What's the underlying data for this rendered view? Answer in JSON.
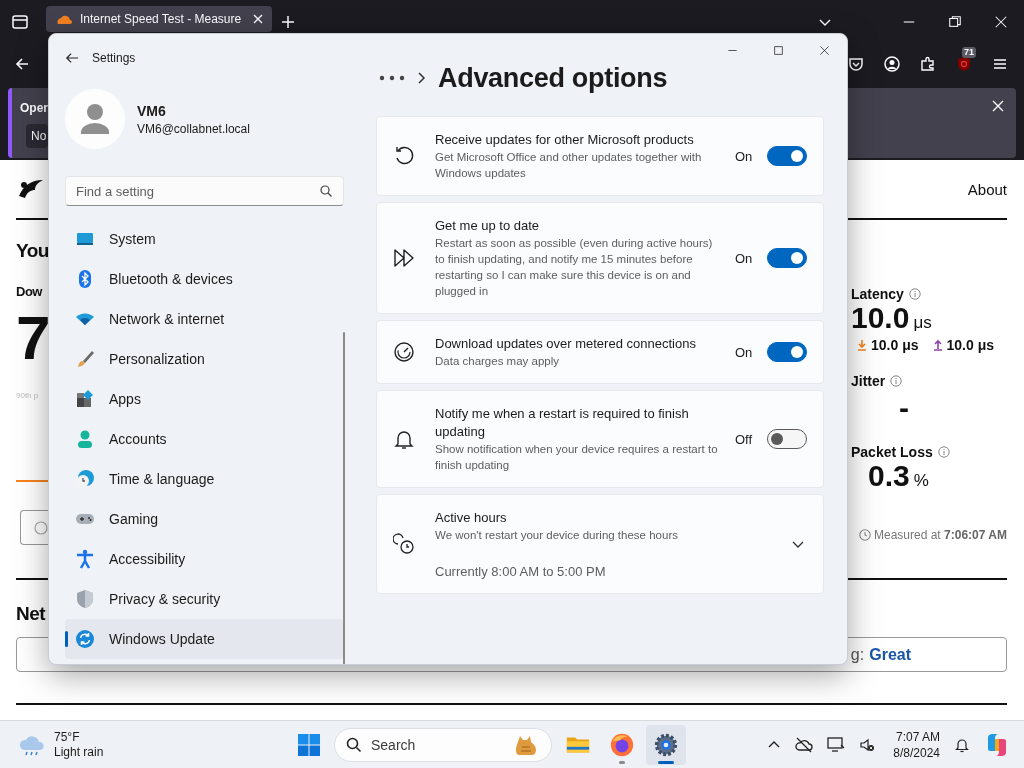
{
  "browser": {
    "tab": {
      "title": "Internet Speed Test - Measure",
      "selected": true
    },
    "extension_badge": "71",
    "notification": {
      "text": "Oper",
      "button": "No"
    }
  },
  "web_page": {
    "nav_link": "About",
    "heading": "You",
    "download_label": "Dow",
    "download_value": "7",
    "percentile_note": "90th p",
    "latency": {
      "label": "Latency",
      "value": "10.0",
      "unit": "μs",
      "down": "10.0 μs",
      "up": "10.0 μs"
    },
    "jitter": {
      "label": "Jitter",
      "value": "-"
    },
    "packet_loss": {
      "label": "Packet Loss",
      "value": "0.3",
      "unit": "%"
    },
    "measured": "Measured at **7:06:07 AM**",
    "section_heading": "Net",
    "rating": {
      "label": "g:",
      "value": "Great"
    }
  },
  "settings": {
    "title": "Settings",
    "user": {
      "name": "VM6",
      "email": "VM6@collabnet.local"
    },
    "search": {
      "placeholder": "Find a setting"
    },
    "nav": [
      {
        "label": "System",
        "selected": false
      },
      {
        "label": "Bluetooth & devices",
        "selected": false
      },
      {
        "label": "Network & internet",
        "selected": false
      },
      {
        "label": "Personalization",
        "selected": false
      },
      {
        "label": "Apps",
        "selected": false
      },
      {
        "label": "Accounts",
        "selected": false
      },
      {
        "label": "Time & language",
        "selected": false
      },
      {
        "label": "Gaming",
        "selected": false
      },
      {
        "label": "Accessibility",
        "selected": false
      },
      {
        "label": "Privacy & security",
        "selected": false
      },
      {
        "label": "Windows Update",
        "selected": true
      }
    ],
    "page_title": "Advanced options",
    "options": [
      {
        "kind": "toggle",
        "title": "Receive updates for other Microsoft products",
        "description": "Get Microsoft Office and other updates together with Windows updates",
        "state_label": "On",
        "on": true
      },
      {
        "kind": "toggle",
        "title": "Get me up to date",
        "description": "Restart as soon as possible (even during active hours) to finish updating, and notify me 15 minutes before restarting so I can make sure this device is on and plugged in",
        "state_label": "On",
        "on": true
      },
      {
        "kind": "toggle",
        "title": "Download updates over metered connections",
        "description": "Data charges may apply",
        "state_label": "On",
        "on": true
      },
      {
        "kind": "toggle",
        "title": "Notify me when a restart is required to finish updating",
        "description": "Show notification when your device requires a restart to finish updating",
        "state_label": "Off",
        "on": false
      },
      {
        "kind": "expander",
        "title": "Active hours",
        "description": "We won't restart your device during these hours",
        "value": "Currently 8:00 AM to 5:00 PM",
        "expanded": false
      }
    ]
  },
  "taskbar": {
    "weather": {
      "temperature": "75°F",
      "condition": "Light rain"
    },
    "search": {
      "placeholder": "Search"
    },
    "apps": [
      {
        "kind": "files",
        "running": false,
        "active": false
      },
      {
        "kind": "browser",
        "running": true,
        "active": false
      },
      {
        "kind": "settings",
        "running": true,
        "active": true
      }
    ],
    "clock": {
      "time": "7:07 AM",
      "date": "8/8/2024"
    }
  }
}
